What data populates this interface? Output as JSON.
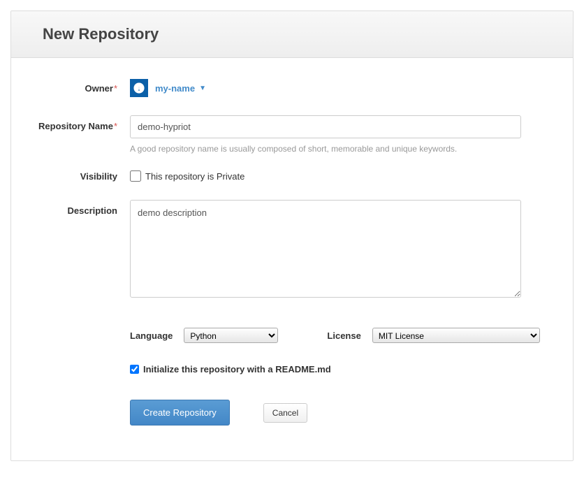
{
  "header": {
    "title": "New Repository"
  },
  "owner": {
    "label": "Owner",
    "required_mark": "*",
    "name": "my-name",
    "caret": "▼"
  },
  "repo_name": {
    "label": "Repository Name",
    "required_mark": "*",
    "value": "demo-hypriot",
    "help": "A good repository name is usually composed of short, memorable and unique keywords."
  },
  "visibility": {
    "label": "Visibility",
    "checkbox_label": "This repository is Private"
  },
  "description": {
    "label": "Description",
    "value": "demo description"
  },
  "language": {
    "label": "Language",
    "selected": "Python"
  },
  "license": {
    "label": "License",
    "selected": "MIT License"
  },
  "init_readme": {
    "label": "Initialize this repository with a README.md"
  },
  "buttons": {
    "create": "Create Repository",
    "cancel": "Cancel"
  }
}
